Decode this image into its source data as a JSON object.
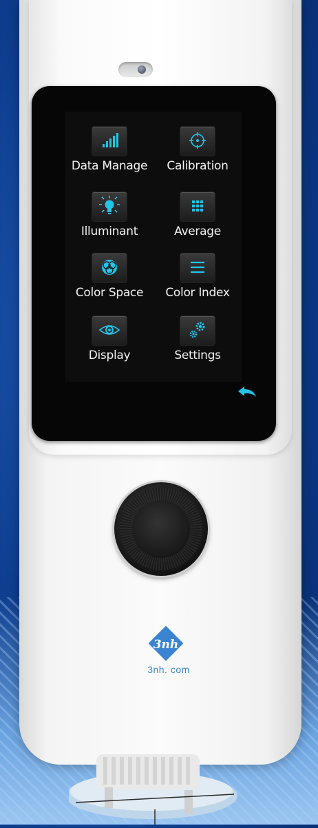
{
  "screen": {
    "menu": [
      {
        "label": "Data Manage",
        "icon": "signal-bars-icon"
      },
      {
        "label": "Calibration",
        "icon": "target-crosshair-icon"
      },
      {
        "label": "Illuminant",
        "icon": "lightbulb-icon"
      },
      {
        "label": "Average",
        "icon": "grid-dots-icon"
      },
      {
        "label": "Color Space",
        "icon": "color-circles-icon"
      },
      {
        "label": "Color Index",
        "icon": "list-lines-icon"
      },
      {
        "label": "Display",
        "icon": "eye-icon"
      },
      {
        "label": "Settings",
        "icon": "gears-icon"
      }
    ],
    "back_icon": "back-arrow-icon"
  },
  "device": {
    "brand": "3nh. com",
    "logo_text": "3nh"
  },
  "colors": {
    "accent": "#22c4e8",
    "screen_bg": "#0d0d0d",
    "label": "#f2f2f2",
    "brand_blue": "#3b84d2"
  }
}
